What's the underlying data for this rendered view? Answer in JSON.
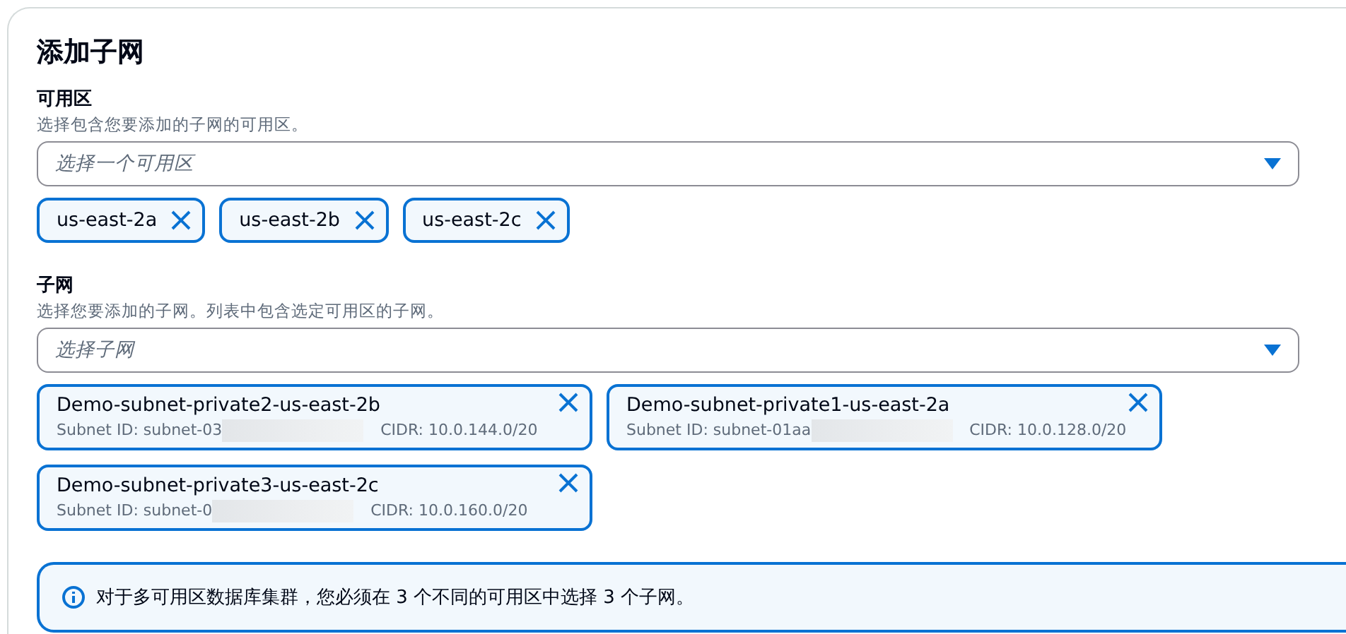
{
  "title": "添加子网",
  "availability_zones": {
    "label": "可用区",
    "description": "选择包含您要添加的子网的可用区。",
    "placeholder": "选择一个可用区",
    "tokens": [
      {
        "label": "us-east-2a"
      },
      {
        "label": "us-east-2b"
      },
      {
        "label": "us-east-2c"
      }
    ]
  },
  "subnets": {
    "label": "子网",
    "description": "选择您要添加的子网。列表中包含选定可用区的子网。",
    "placeholder": "选择子网",
    "tokens": [
      {
        "name": "Demo-subnet-private2-us-east-2b",
        "subnet_id": "Subnet ID: subnet-03",
        "cidr": "CIDR: 10.0.144.0/20"
      },
      {
        "name": "Demo-subnet-private1-us-east-2a",
        "subnet_id": "Subnet ID: subnet-01aa",
        "cidr": "CIDR: 10.0.128.0/20"
      },
      {
        "name": "Demo-subnet-private3-us-east-2c",
        "subnet_id": "Subnet ID: subnet-0",
        "cidr": "CIDR: 10.0.160.0/20"
      }
    ]
  },
  "alert": {
    "text": "对于多可用区数据库集群，您必须在 3 个不同的可用区中选择 3 个子网。"
  }
}
